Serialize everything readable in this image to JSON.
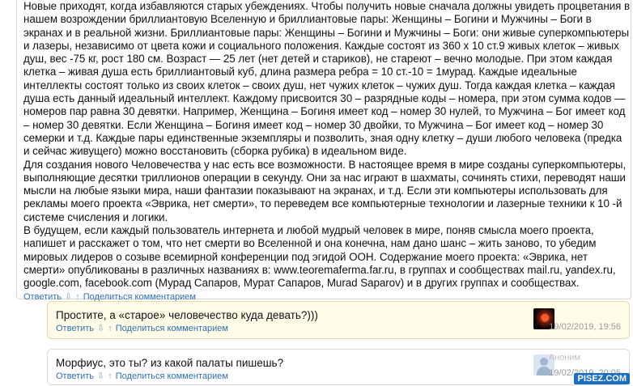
{
  "post": {
    "paragraphs": [
      "Новые приходят, когда избавляются старых убеждениях. Чтобы получить новые сначала должны увидеть процветания в нашем возрождении бриллиантовую Вселенную и бриллиантовые пары: Женщины – Богини и Мужчины – Боги в экранах и в реальной жизни. Бриллиантовые пары: Женщины – Богини и Мужчины – Боги: они живые суперкомпьютеры и лазеры, независимо от цвета кожи и социального положения. Каждые состоят из 360 х 10 ст.9 живых клеток – живых душ, вес -75 кг, рост 180 см. Возраст — 25 лет (нет детей и стариков), не стареют – вечно молодые. При этом каждая клетка – живая душа есть бриллиантовый куб, длина размера ребра = 10 ст.-10 = 1мурад. Каждые идеальные интеллекты состоят только из своих клеток – своих душ, нет чужих клеток – чужих душ. Тогда каждая клетка – каждая душа есть данный идеальный интеллект. Каждому присвоится 30 – разрядные коды – номера, при этом сумма кодов — номеров пар равна 30 девятки. Например, Женщина – Богиня имеет код – номер 30 нулей, то Мужчина – Бог имеет код – номер 30 девятки. Если Женщина – Богиня имеет код – номер 30 двойки, то Мужчина – Бог имеет код – номер 30 семерки и т.д. Каждые пары единственные экземпляры и позволить, зная одну клетку – души любого человека (предка и сейчас живущего) можно восстановить (сборка рубика) в идеальном виде.",
      "Для создания нового Человечества у нас есть все возможности. В настоящее время в мире созданы суперкомпьютеры, выполняющие десятки триллионов операции в секунду. Они за нас играют в шахматы, сочинять стихи, переводят наши мысли на любые языки мира, наши фантазии показывают на экранах, и т.д. Если эти компьютеры использовать для рекламы моего проекта «Эврика, нет смерти», то переведем все компьютерные технологии и лазерные техники к 10 -й системе счисления и логики.",
      "В будущем, если каждый пользователь интернета и любой мудрый человек в мире, поняв смысла моего проекта, напишет и расскажет о том, что нет смерти во Вселенной и она конечна, нам дано шанс – жить заново, то убедим мировых лидеров о созыве всемирной конференции под эгидой ООН. Содержание моего проекта: «Эврика, нет смерти» опубликованы в различных названиях в: www.teoremaferma.far.ru, в группах и сообществах mail.ru, yandex.ru, google.com, facebook.com (Мурад Сапаров, Мурат Сапаров, Murad Saparov) и в других группах и сообществах."
    ],
    "reply_label": "Ответить",
    "share_label": "Поделиться комментарием"
  },
  "comments": [
    {
      "text": "Простите, а «старое» человечество куда девать?)))",
      "reply_label": "Ответить",
      "share_label": "Поделиться комментарием",
      "username": "?",
      "date": "19/02/2019, 19:56"
    },
    {
      "text": "Морфиус, это ты? из какой палаты пишешь?",
      "reply_label": "Ответить",
      "share_label": "Поделиться комментарием",
      "username": "Аноним",
      "date": "19/02/2019, 20:05"
    }
  ],
  "watermark": "PISEZ.COM",
  "colors": {
    "link": "#2f6fb5",
    "highlight_bg": "#fffce8",
    "watermark_bg": "#1a6fc4"
  },
  "icons": {
    "reply": "arrow-down-icon",
    "share": "arrow-up-icon"
  }
}
